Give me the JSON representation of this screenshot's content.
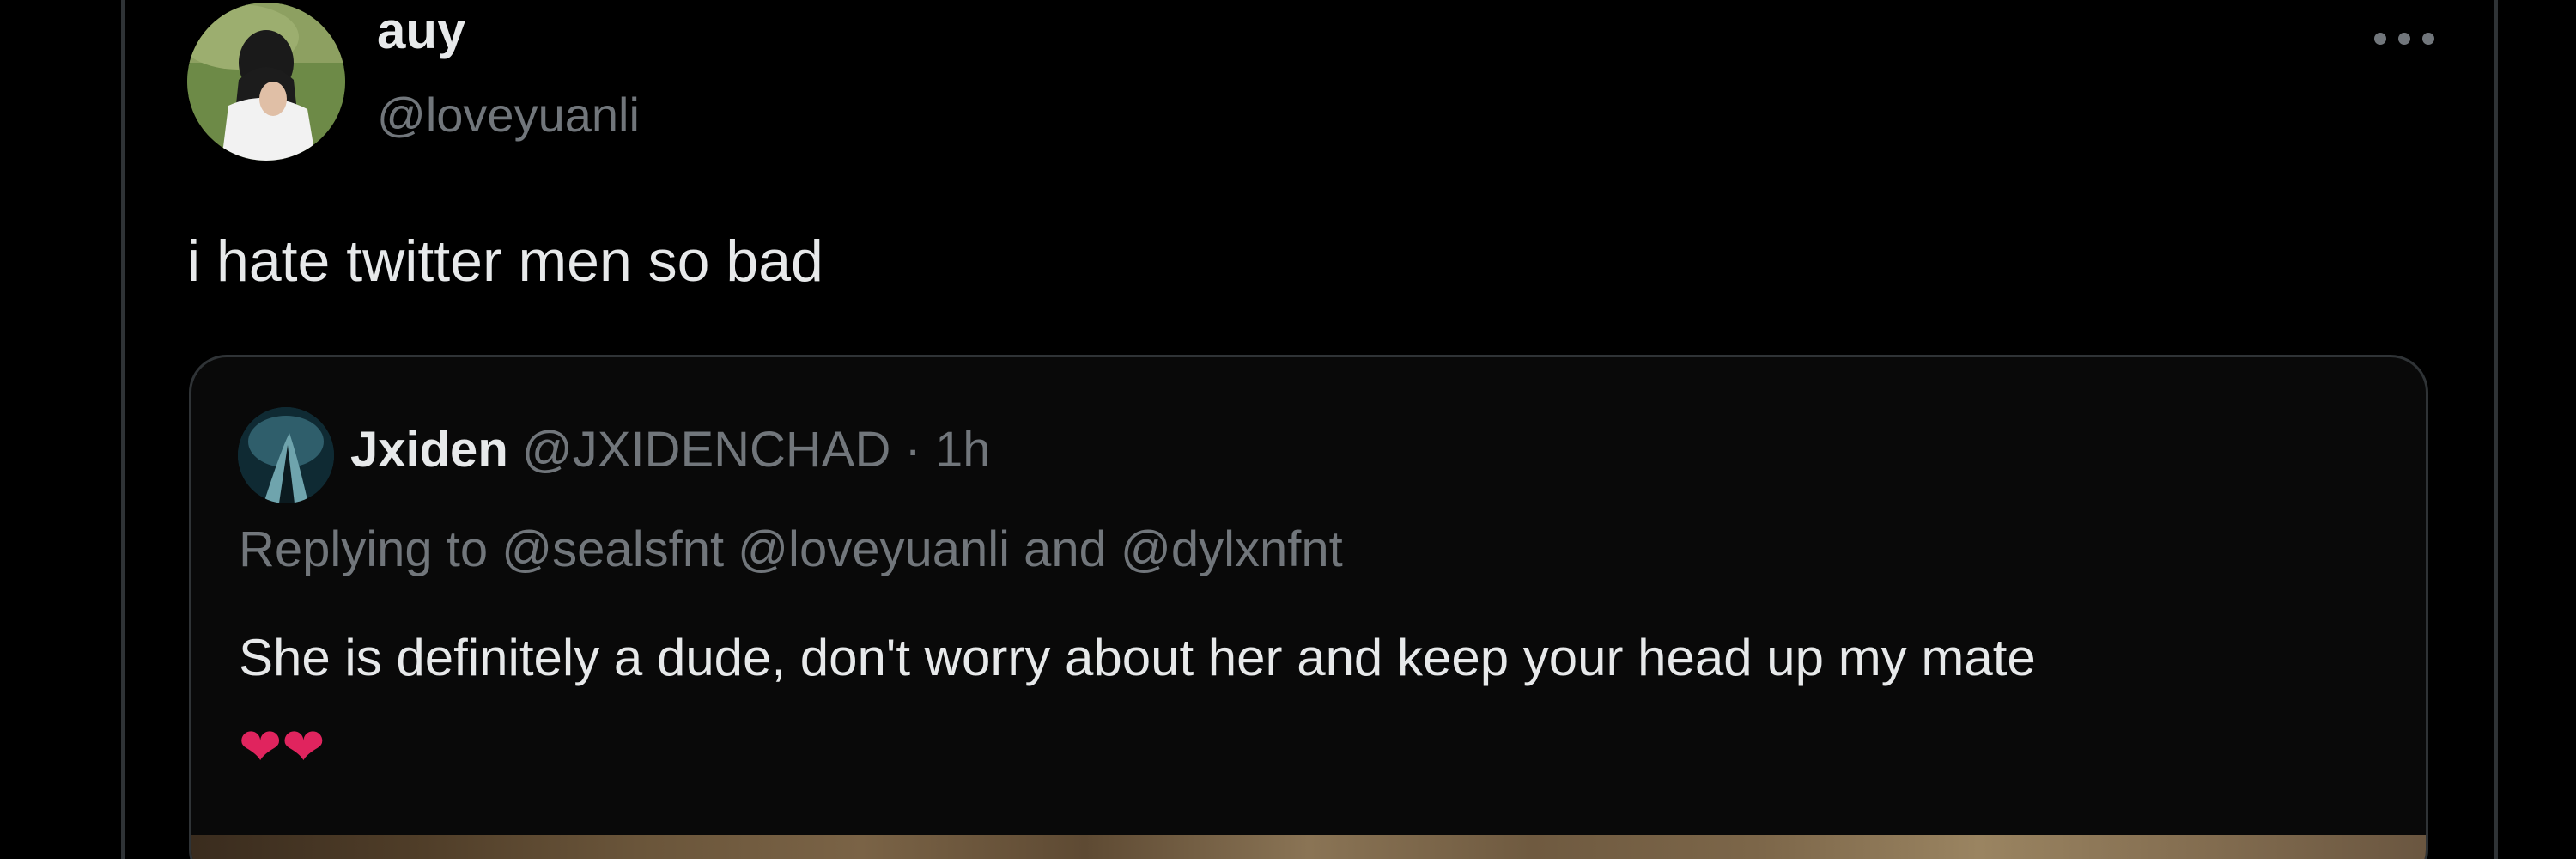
{
  "post": {
    "display_name": "auy",
    "handle": "@loveyuanli",
    "text": "i hate twitter men so bad",
    "more_icon": "more-horizontal-icon"
  },
  "quote": {
    "display_name": "Jxiden",
    "handle": "@JXIDENCHAD",
    "separator": "·",
    "time": "1h",
    "replying_prefix": "Replying to",
    "replying_users": "@sealsfnt @loveyuanli and @dylxnfnt",
    "text": "She is definitely a dude, don't worry about her and keep your head up my mate",
    "emoji": "❤❤"
  },
  "colors": {
    "background": "#000000",
    "text_primary": "#e7e9ea",
    "text_secondary": "#71767b",
    "border": "#2f3336",
    "heart": "#e0245e"
  }
}
